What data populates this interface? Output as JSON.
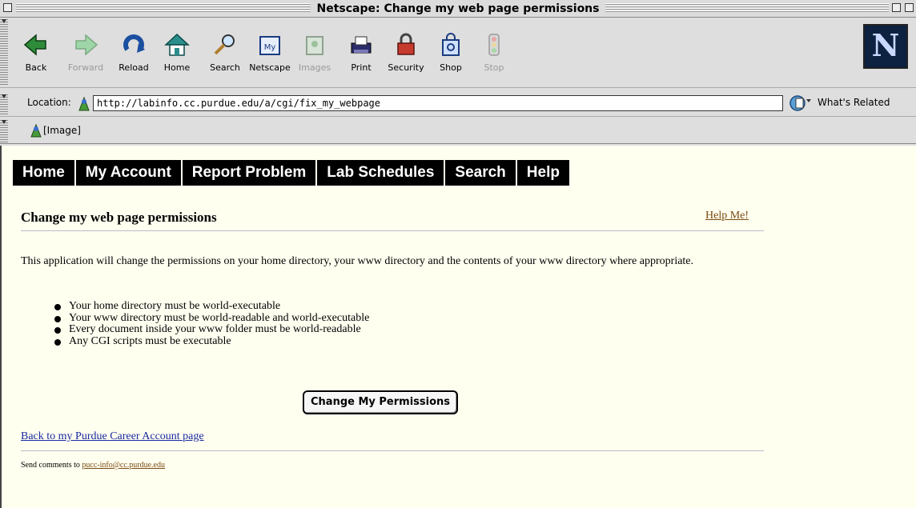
{
  "window": {
    "title": "Netscape: Change my web page permissions"
  },
  "toolbar": {
    "buttons": [
      {
        "label": "Back",
        "icon": "back-arrow-icon",
        "enabled": true
      },
      {
        "label": "Forward",
        "icon": "forward-arrow-icon",
        "enabled": false
      },
      {
        "label": "Reload",
        "icon": "reload-icon",
        "enabled": true
      },
      {
        "label": "Home",
        "icon": "home-icon",
        "enabled": true
      },
      {
        "label": "Search",
        "icon": "search-icon",
        "enabled": true
      },
      {
        "label": "Netscape",
        "icon": "netscape-my-icon",
        "enabled": true
      },
      {
        "label": "Images",
        "icon": "images-icon",
        "enabled": false
      },
      {
        "label": "Print",
        "icon": "print-icon",
        "enabled": true
      },
      {
        "label": "Security",
        "icon": "lock-icon",
        "enabled": true
      },
      {
        "label": "Shop",
        "icon": "shopping-bag-icon",
        "enabled": true
      },
      {
        "label": "Stop",
        "icon": "stop-icon",
        "enabled": false
      }
    ],
    "logo_letter": "N"
  },
  "location": {
    "label": "Location:",
    "url": "http://labinfo.cc.purdue.edu/a/cgi/fix_my_webpage",
    "related_label": "What's Related"
  },
  "personal_toolbar": {
    "item_label": "[Image]"
  },
  "page": {
    "nav": [
      "Home",
      "My Account",
      "Report Problem",
      "Lab Schedules",
      "Search",
      "Help"
    ],
    "heading": "Change my web page permissions",
    "help_link": "Help Me!",
    "intro": "This application will change the permissions on your home directory, your www directory and the contents of your www directory where appropriate.",
    "requirements": [
      "Your home directory must be world-executable",
      "Your www directory must be world-readable and world-executable",
      "Every document inside your www folder must be world-readable",
      "Any CGI scripts must be executable"
    ],
    "button_label": "Change My Permissions",
    "back_link": "Back to my Purdue Career Account page",
    "footer_prefix": "Send comments to ",
    "footer_email": "pucc-info@cc.purdue.edu"
  },
  "colors": {
    "page_background": "#fffff0",
    "nav_background": "#000000",
    "link_visited": "#7a4a10",
    "link": "#1a2aa0"
  }
}
